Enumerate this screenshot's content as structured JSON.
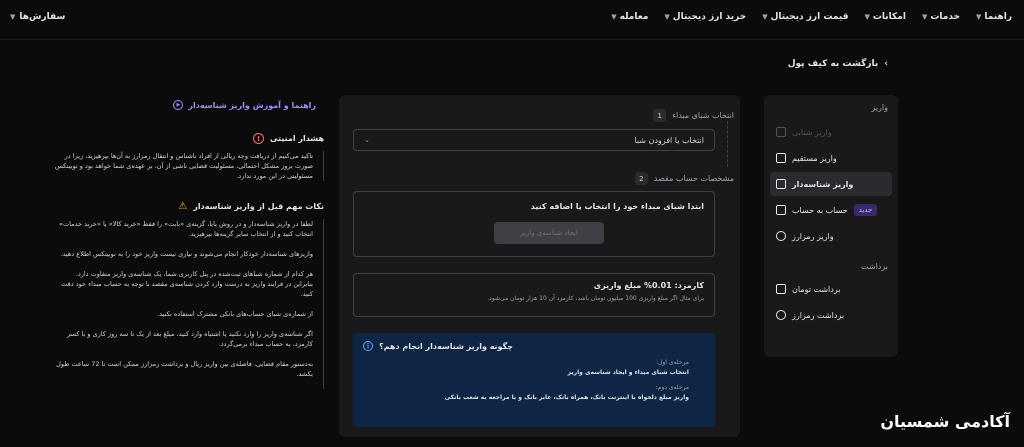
{
  "nav": {
    "orders": "سفارش‌ها",
    "items": [
      "معامله",
      "خرید ارز دیجیتال",
      "قیمت ارز دیجیتال",
      "امکانات",
      "خدمات",
      "راهنما"
    ]
  },
  "back_label": "بازگشت به کیف پول",
  "sidebar": {
    "deposit_heading": "واریز",
    "items": [
      {
        "label": "واریز شتابی",
        "state": "disabled"
      },
      {
        "label": "واریز مستقیم",
        "state": "normal"
      },
      {
        "label": "واریز شناسه‌دار",
        "state": "active"
      },
      {
        "label": "حساب به حساب",
        "state": "normal",
        "badge": "جدید"
      },
      {
        "label": "واریز رمزارز",
        "state": "normal"
      }
    ],
    "withdraw_heading": "برداشت",
    "withdraw_items": [
      {
        "label": "برداشت تومان"
      },
      {
        "label": "برداشت رمزارز"
      }
    ]
  },
  "main": {
    "step1": {
      "num": "1",
      "label": "انتخاب شبای مبداء"
    },
    "select_placeholder": "انتخاب یا افزودن شبا",
    "step2": {
      "num": "2",
      "label": "مشخصات حساب مقصد"
    },
    "dest_title": "ابتدا شبای مبداء خود را انتخاب یا اضافه کنید",
    "dest_button": "ایجاد شناسه‌ی واریز",
    "fee_title": "کارمزد: 0.01% مبلغ واریزی",
    "fee_desc": "برای مثال اگر مبلغ واریزی 100 میلیون تومان باشد، کارمزد آن 10 هزار تومان می‌شود.",
    "how_title": "چگونه واریز شناسه‌دار انجام دهم؟",
    "stage1_label": "مرحله‌ی اول:",
    "stage1_text": "انتخاب شبای مبداء و ایجاد شناسه‌ی واریز",
    "stage2_label": "مرحله‌ی دوم:",
    "stage2_text": "واریز مبلغ دلخواه با اینترنت بانک، همراه بانک، عابر بانک و یا مراجعه به شعب بانکی"
  },
  "guide": {
    "link": "راهنما و آموزش واریز شناسه‌دار",
    "security_title": "هشدار امنیتی",
    "security_body": "تاکید می‌کنیم از دریافت وجه ریالی از افراد ناشناس و انتقال رمزارز به آن‌ها بپرهیزید، زیرا در صورت بروز مشکل احتمالی، مسئولیت قضایی ناشی از آن، بر عهده‌ی شما خواهد بود و نوبیتکس مسئولیتی در این مورد ندارد.",
    "tips_title": "نکات مهم قبل از واریز شناسه‌دار",
    "tips": [
      "لطفا در واریز شناسه‌دار و در روش پایا، گزینه‌ی «بابت» را فقط «خرید کالا» یا «خرید خدمات» انتخاب کنید و از انتخاب سایر گزینه‌ها بپرهیزید.",
      "واریزهای شناسه‌دار خودکار انجام می‌شوند و نیازی نیست واریز خود را به نوبیتکس اطلاع دهید.",
      "هر کدام از شماره شباهای ثبت‌شده در پنل کاربری شما، یک شناسه‌ی واریز متفاوت دارد. بنابراین در فرایند واریز به درست وارد کردن شناسه‌ی مقصد با توجه به حساب مبداء خود دقت کنید.",
      "از شماره‌ی شبای حساب‌های بانکی مشترک استفاده نکنید.",
      "اگر شناسه‌ی واریز را وارد نکنید یا اشتباه وارد کنید، مبلغ بعد از یک تا سه روز کاری و با کسر کارمزد، به حساب مبداء برمی‌گردد.",
      "به‌دستور مقام قضایی، فاصله‌ی بین واریز ریال و برداشت رمزارز ممکن است تا 72 ساعت طول بکشد."
    ]
  },
  "watermark": "آکادمی شمسیان"
}
